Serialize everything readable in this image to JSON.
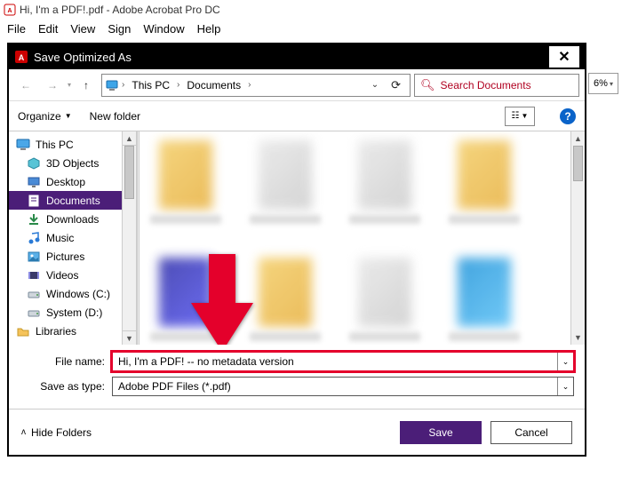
{
  "app": {
    "title": "Hi, I'm a PDF!.pdf - Adobe Acrobat Pro DC",
    "zoom_hint": "6%"
  },
  "menubar": [
    "File",
    "Edit",
    "View",
    "Sign",
    "Window",
    "Help"
  ],
  "dialog": {
    "title": "Save Optimized As",
    "breadcrumb": {
      "root_icon": "monitor-icon",
      "seg1": "This PC",
      "seg2": "Documents"
    },
    "search_placeholder": "Search Documents",
    "toolbar": {
      "organize": "Organize",
      "new_folder": "New folder"
    },
    "tree": [
      {
        "label": "This PC",
        "icon": "monitor",
        "top": true,
        "selected": false
      },
      {
        "label": "3D Objects",
        "icon": "cube",
        "top": false,
        "selected": false
      },
      {
        "label": "Desktop",
        "icon": "desktop",
        "top": false,
        "selected": false
      },
      {
        "label": "Documents",
        "icon": "doc",
        "top": false,
        "selected": true
      },
      {
        "label": "Downloads",
        "icon": "download",
        "top": false,
        "selected": false
      },
      {
        "label": "Music",
        "icon": "music",
        "top": false,
        "selected": false
      },
      {
        "label": "Pictures",
        "icon": "picture",
        "top": false,
        "selected": false
      },
      {
        "label": "Videos",
        "icon": "video",
        "top": false,
        "selected": false
      },
      {
        "label": "Windows (C:)",
        "icon": "drive",
        "top": false,
        "selected": false
      },
      {
        "label": "System (D:)",
        "icon": "drive",
        "top": false,
        "selected": false
      },
      {
        "label": "Libraries",
        "icon": "folder",
        "top": true,
        "selected": false
      }
    ],
    "form": {
      "filename_label": "File name:",
      "filename_value": "Hi, I'm a PDF! -- no metadata version",
      "type_label": "Save as type:",
      "type_value": "Adobe PDF Files (*.pdf)"
    },
    "footer": {
      "hide_folders": "Hide Folders",
      "save": "Save",
      "cancel": "Cancel"
    }
  }
}
